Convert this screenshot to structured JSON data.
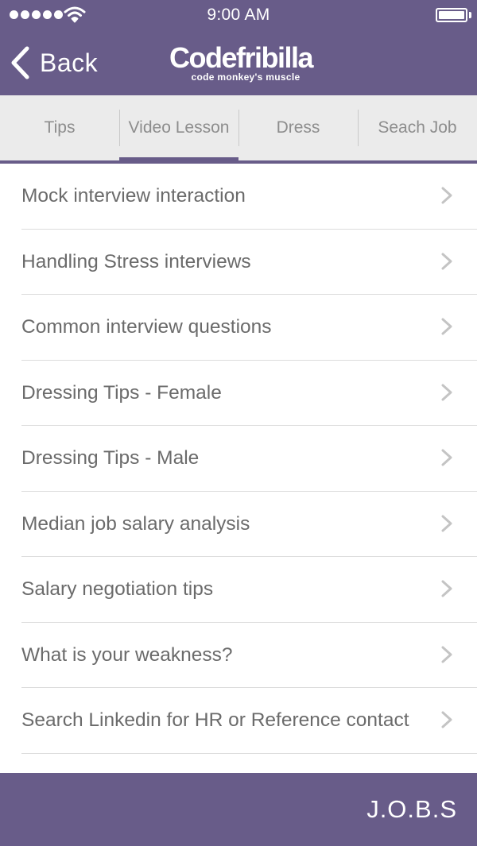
{
  "status_bar": {
    "time": "9:00 AM",
    "signal_dots": 5,
    "icons": [
      "signal-dots-icon",
      "wifi-icon",
      "battery-icon"
    ]
  },
  "nav": {
    "back_label": "Back",
    "back_icon": "chevron-left-icon",
    "logo_name": "Codefribilla",
    "logo_tagline": "code monkey's muscle"
  },
  "tabs": [
    {
      "label": "Tips",
      "active": false
    },
    {
      "label": "Video Lesson",
      "active": true
    },
    {
      "label": "Dress",
      "active": false
    },
    {
      "label": "Seach Job",
      "active": false
    }
  ],
  "list": {
    "row_icon": "chevron-right-icon",
    "items": [
      {
        "label": "Mock interview interaction"
      },
      {
        "label": "Handling Stress interviews"
      },
      {
        "label": "Common interview questions"
      },
      {
        "label": "Dressing Tips - Female"
      },
      {
        "label": "Dressing Tips - Male"
      },
      {
        "label": "Median job salary analysis"
      },
      {
        "label": "Salary negotiation tips"
      },
      {
        "label": "What is your weakness?"
      },
      {
        "label": "Search Linkedin for HR or Reference contact"
      }
    ]
  },
  "footer": {
    "brand": "J.O.B.S"
  },
  "colors": {
    "primary_purple": "#685c89",
    "tab_background": "#ebebeb",
    "tab_text": "#8d8d8d",
    "list_text": "#6b6b6b",
    "chevron": "#c4c4c4",
    "separator": "#dcdcdc"
  }
}
